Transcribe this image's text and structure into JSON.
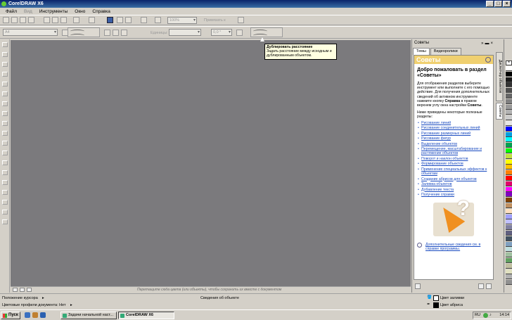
{
  "window": {
    "title": "CorelDRAW X6"
  },
  "menu": [
    {
      "label": "Файл",
      "enabled": true
    },
    {
      "label": "Вид",
      "enabled": false
    },
    {
      "label": "Инструменты",
      "enabled": true
    },
    {
      "label": "Окно",
      "enabled": true
    },
    {
      "label": "Справка",
      "enabled": true
    }
  ],
  "toolbar": {
    "zoom_value": "100%",
    "snap_label": "Привязать к",
    "paper_value": "A4",
    "units_label": "Единицы:",
    "angle_value": "0,0 °"
  },
  "tooltip": {
    "title": "Дублировать расстояние",
    "text": "Задать расстояние между исходным и дублированным объектом."
  },
  "canvas": {
    "hint": "Перетащите сюда цвета (или объекты), чтобы сохранить их вместе с документом"
  },
  "docker": {
    "title": "Советы",
    "tabs": [
      "Темы",
      "Видеоролики"
    ],
    "heading": "Советы",
    "welcome": "Добро пожаловать в раздел «Советы»",
    "intro_before": "Для отображения разделов выберите инструмент или выполните с его помощью действие. Для получения дополнительных сведений об активном инструменте нажмите кнопку ",
    "intro_bold1": "Справка",
    "intro_middle": " в правом верхнем углу окна настройки ",
    "intro_bold2": "Советы",
    "intro_after": ".",
    "list_intro": "Ниже приведены некоторые полезные разделы:",
    "links": [
      "Рисование линий",
      "Рисование соединительных линий",
      "Рисование размерных линий",
      "Рисование фигур",
      "Выделение объектов",
      "Перемещение, масштабирование и растяжение объектов",
      "Поворот и наклон объектов",
      "Формирование объектов",
      "Применение специальных эффектов к объектам",
      "Создание абрисов для объектов",
      "Заливка объектов",
      "Добавление текста",
      "Получение справки"
    ],
    "more": "Дополнительные сведения см. в справке программы."
  },
  "side_tabs": [
    "Диспетчер объектов",
    "Советы"
  ],
  "palette_colors": [
    "#ffffff",
    "#000000",
    "#1a1a1a",
    "#333333",
    "#4d4d4d",
    "#666666",
    "#808080",
    "#999999",
    "#b3b3b3",
    "#cccccc",
    "#e6e6e6",
    "#0000ff",
    "#00a0e0",
    "#00ffff",
    "#00a050",
    "#00ff00",
    "#c0e040",
    "#ffff00",
    "#ffc000",
    "#ff8000",
    "#ff0000",
    "#e0006a",
    "#ff00ff",
    "#8000c0",
    "#804000",
    "#c09060",
    "#ffe0c0",
    "#a0a0ff",
    "#c0c0ff",
    "#8080a0",
    "#606080",
    "#405060",
    "#80a0c0",
    "#c0e0e0",
    "#a0c0a0",
    "#60a060",
    "#c0c0a0",
    "#e0e0c0",
    "#b0b0b0",
    "#909090"
  ],
  "status": {
    "cursor_position": "Положение курсора",
    "object_info": "Сведения об объекте",
    "color_profiles": "Цветовые профили документа: Нет",
    "fill_label": "Цвет заливки",
    "outline_label": "Цвет абриса"
  },
  "taskbar": {
    "start": "Пуск",
    "tasks": [
      {
        "label": "Задачи начальной наст...",
        "active": false
      },
      {
        "label": "CorelDRAW X6",
        "active": true
      }
    ],
    "lang": "RU",
    "clock": "14:14"
  }
}
